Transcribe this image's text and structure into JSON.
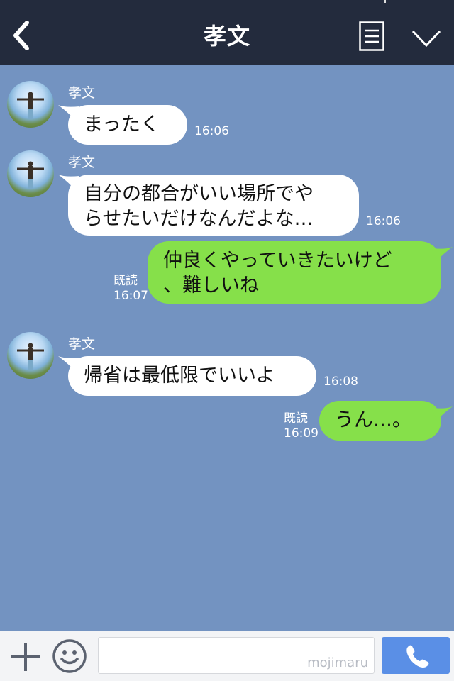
{
  "header": {
    "title": "孝文",
    "back_icon": "chevron-left-icon",
    "menu_icon": "menu-list-icon",
    "more_icon": "chevron-down-icon"
  },
  "colors": {
    "header_bg": "#232b3d",
    "chat_bg": "#7393c1",
    "incoming_bubble": "#ffffff",
    "outgoing_bubble": "#86e04a",
    "call_button": "#5a8fe6"
  },
  "messages": [
    {
      "direction": "in",
      "sender": "孝文",
      "lines": [
        "まったく"
      ],
      "time": "16:06"
    },
    {
      "direction": "in",
      "sender": "孝文",
      "lines": [
        "自分の都合がいい場所でや",
        "らせたいだけなんだよな…"
      ],
      "time": "16:06"
    },
    {
      "direction": "out",
      "read": "既読",
      "lines": [
        "仲良くやっていきたいけど",
        "、難しいね"
      ],
      "time": "16:07"
    },
    {
      "direction": "in",
      "sender": "孝文",
      "lines": [
        "帰省は最低限でいいよ"
      ],
      "time": "16:08"
    },
    {
      "direction": "out",
      "read": "既読",
      "lines": [
        "うん…。"
      ],
      "time": "16:09"
    }
  ],
  "composer": {
    "plus_icon": "plus-icon",
    "emoji_icon": "smiley-icon",
    "input_value": "",
    "watermark": "mojimaru",
    "call_icon": "phone-icon"
  }
}
